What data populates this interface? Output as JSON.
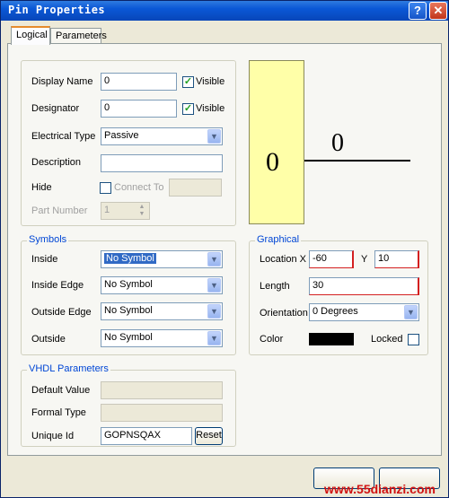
{
  "window": {
    "title": "Pin Properties",
    "help_label": "?",
    "close_label": "✕"
  },
  "tabs": [
    {
      "label": "Logical"
    },
    {
      "label": "Parameters"
    }
  ],
  "properties": {
    "display_name": {
      "label": "Display Name",
      "value": "0",
      "visible_label": "Visible",
      "visible_checked": true
    },
    "designator": {
      "label": "Designator",
      "value": "0",
      "visible_label": "Visible",
      "visible_checked": true
    },
    "electrical_type": {
      "label": "Electrical Type",
      "value": "Passive"
    },
    "description": {
      "label": "Description",
      "value": ""
    },
    "hide": {
      "label": "Hide",
      "connect_to_label": "Connect To",
      "checked": false,
      "value": ""
    },
    "part_number": {
      "label": "Part Number",
      "value": "1"
    }
  },
  "preview": {
    "pin_number": "0",
    "pin_name": "0"
  },
  "symbols": {
    "title": "Symbols",
    "inside": {
      "label": "Inside",
      "value": "No Symbol"
    },
    "inside_edge": {
      "label": "Inside Edge",
      "value": "No Symbol"
    },
    "outside_edge": {
      "label": "Outside Edge",
      "value": "No Symbol"
    },
    "outside": {
      "label": "Outside",
      "value": "No Symbol"
    }
  },
  "graphical": {
    "title": "Graphical",
    "location_label": "Location X",
    "x_value": "-60",
    "y_label": "Y",
    "y_value": "10",
    "length": {
      "label": "Length",
      "value": "30"
    },
    "orientation": {
      "label": "Orientation",
      "value": "0 Degrees"
    },
    "color": {
      "label": "Color",
      "value": "#000000"
    },
    "locked": {
      "label": "Locked",
      "checked": false
    }
  },
  "vhdl": {
    "title": "VHDL Parameters",
    "default_value": {
      "label": "Default Value",
      "value": ""
    },
    "formal_type": {
      "label": "Formal Type",
      "value": ""
    },
    "unique_id": {
      "label": "Unique Id",
      "value": "GOPNSQAX",
      "reset_label": "Reset"
    }
  },
  "watermark": "www.55dianzi.com"
}
